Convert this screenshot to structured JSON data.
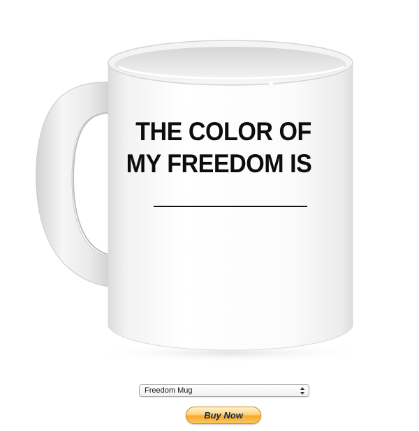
{
  "product": {
    "mug_text_line1": "THE COLOR OF",
    "mug_text_line2": "MY FREEDOM IS"
  },
  "form": {
    "selected_option": "Freedom Mug",
    "buy_button_label": "Buy Now"
  },
  "icons": {
    "select_arrows": "updown-arrows-icon"
  },
  "colors": {
    "button_gradient_top": "#fff3cf",
    "button_gradient_bottom": "#f7a82e",
    "button_text": "#0e2a5a",
    "mug_text": "#0d0d0d"
  }
}
